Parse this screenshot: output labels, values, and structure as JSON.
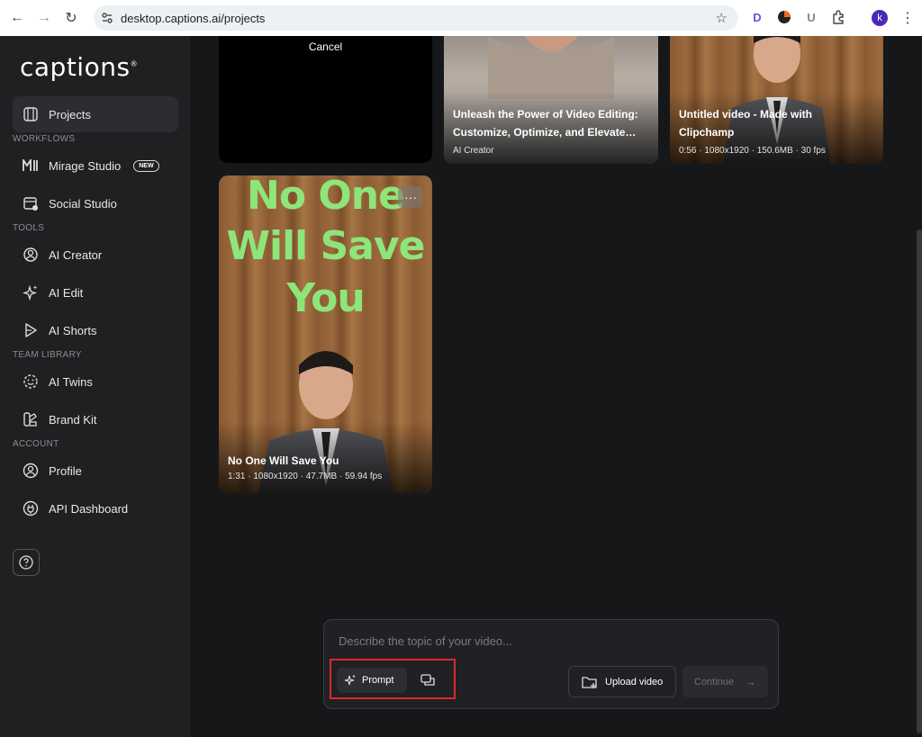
{
  "browser": {
    "url": "desktop.captions.ai/projects",
    "extensions": [
      "D",
      "U"
    ],
    "profile_initial": "k"
  },
  "sidebar": {
    "logo": "captions",
    "items": [
      {
        "label": "Projects",
        "icon": "film-icon"
      },
      {
        "label": "Mirage Studio",
        "icon": "mirage-icon",
        "badge": "NEW"
      },
      {
        "label": "Social Studio",
        "icon": "calendar-icon"
      },
      {
        "label": "AI Creator",
        "icon": "face-scan-icon"
      },
      {
        "label": "AI Edit",
        "icon": "sparkle-icon"
      },
      {
        "label": "AI Shorts",
        "icon": "play-icon"
      },
      {
        "label": "AI Twins",
        "icon": "smiley-icon"
      },
      {
        "label": "Brand Kit",
        "icon": "palette-icon"
      },
      {
        "label": "Profile",
        "icon": "user-circle-icon"
      },
      {
        "label": "API Dashboard",
        "icon": "plug-icon"
      }
    ],
    "sections": {
      "workflows": "WORKFLOWS",
      "tools": "TOOLS",
      "team_library": "TEAM LIBRARY",
      "account": "ACCOUNT"
    }
  },
  "projects": {
    "cancel_label": "Cancel",
    "cards": [
      {
        "title_line1": "Unleash the Power of Video Editing:",
        "title_line2": "Customize, Optimize, and Elevate…",
        "meta": "AI Creator"
      },
      {
        "title_line1": "Untitled video - Made with",
        "title_line2": "Clipchamp",
        "meta": "0:56 · 1080x1920 · 150.6MB · 30 fps"
      },
      {
        "overlay_line1": "No One",
        "overlay_line2": "Will Save",
        "overlay_line3": "You",
        "title": "No One Will Save You",
        "meta": "1:31 · 1080x1920 · 47.7MB · 59.94 fps",
        "more": "···"
      }
    ]
  },
  "prompt": {
    "placeholder": "Describe the topic of your video...",
    "mode_prompt": "Prompt",
    "upload": "Upload video",
    "continue": "Continue",
    "continue_arrow": "→"
  }
}
